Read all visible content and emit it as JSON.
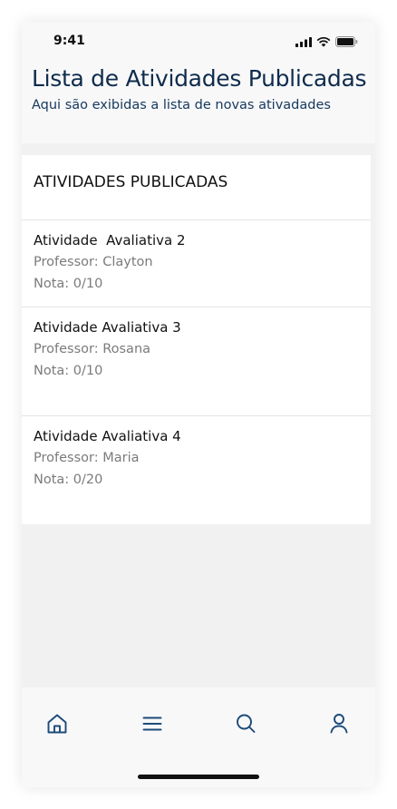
{
  "status_bar": {
    "time": "9:41"
  },
  "header": {
    "title": "Lista de Atividades Publicadas",
    "subtitle": "Aqui são exibidas a lista de novas ativadades"
  },
  "activities_card": {
    "title": "ATIVIDADES PUBLICADAS",
    "items": [
      {
        "title": "Atividade  Avaliativa 2",
        "professor": "Professor: Clayton",
        "grade": "Nota: 0/10"
      },
      {
        "title": "Atividade Avaliativa 3",
        "professor": "Professor: Rosana",
        "grade": "Nota: 0/10"
      },
      {
        "title": "Atividade Avaliativa 4",
        "professor": "Professor: Maria",
        "grade": "Nota: 0/20"
      }
    ]
  },
  "tab_bar": {
    "icons": [
      "home-icon",
      "menu-icon",
      "search-icon",
      "user-icon"
    ],
    "icon_color": "#1c4a78"
  }
}
